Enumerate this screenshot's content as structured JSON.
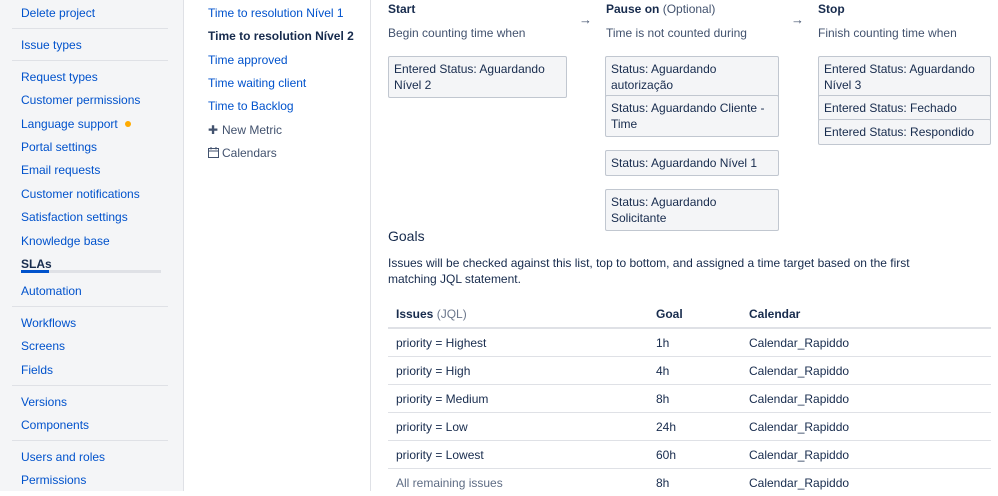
{
  "sidebar": {
    "items": [
      {
        "label": "Delete project"
      },
      {
        "label": "Issue types"
      },
      {
        "label": "Request types"
      },
      {
        "label": "Customer permissions"
      },
      {
        "label": "Language support"
      },
      {
        "label": "Portal settings"
      },
      {
        "label": "Email requests"
      },
      {
        "label": "Customer notifications"
      },
      {
        "label": "Satisfaction settings"
      },
      {
        "label": "Knowledge base"
      },
      {
        "label": "SLAs"
      },
      {
        "label": "Automation"
      },
      {
        "label": "Workflows"
      },
      {
        "label": "Screens"
      },
      {
        "label": "Fields"
      },
      {
        "label": "Versions"
      },
      {
        "label": "Components"
      },
      {
        "label": "Users and roles"
      },
      {
        "label": "Permissions"
      }
    ],
    "sla_progress": 0.2
  },
  "metrics": {
    "items": [
      {
        "label": "Time to resolution Nível 1"
      },
      {
        "label": "Time to resolution Nível 2"
      },
      {
        "label": "Time approved"
      },
      {
        "label": "Time waiting client"
      },
      {
        "label": "Time to Backlog"
      }
    ],
    "new_metric": "New Metric",
    "calendars": "Calendars"
  },
  "conditions": {
    "start": {
      "title": "Start",
      "subtitle": "Begin counting time when",
      "chips": [
        "Entered Status: Aguardando Nível 2"
      ]
    },
    "pause": {
      "title": "Pause on",
      "optional": "(Optional)",
      "subtitle": "Time is not counted during",
      "chips": [
        "Status: Aguardando autorização",
        "Status: Aguardando Cliente - Time",
        "Status: Aguardando Nível 1",
        "Status: Aguardando Solicitante"
      ]
    },
    "stop": {
      "title": "Stop",
      "subtitle": "Finish counting time when",
      "chips": [
        "Entered Status: Aguardando Nível 3",
        "Entered Status: Fechado",
        "Entered Status: Respondido"
      ]
    },
    "arrow": "→"
  },
  "goals": {
    "title": "Goals",
    "description": "Issues will be checked against this list, top to bottom, and assigned a time target based on the first matching JQL statement.",
    "headers": {
      "issues": "Issues",
      "issues_hint": "(JQL)",
      "goal": "Goal",
      "calendar": "Calendar"
    },
    "rows": [
      {
        "issues": "priority = Highest",
        "goal": "1h",
        "calendar": "Calendar_Rapiddo"
      },
      {
        "issues": "priority = High",
        "goal": "4h",
        "calendar": "Calendar_Rapiddo"
      },
      {
        "issues": "priority = Medium",
        "goal": "8h",
        "calendar": "Calendar_Rapiddo"
      },
      {
        "issues": "priority = Low",
        "goal": "24h",
        "calendar": "Calendar_Rapiddo"
      },
      {
        "issues": "priority = Lowest",
        "goal": "60h",
        "calendar": "Calendar_Rapiddo"
      }
    ],
    "remaining": {
      "issues": "All remaining issues",
      "goal": "8h",
      "calendar": "Calendar_Rapiddo"
    }
  }
}
